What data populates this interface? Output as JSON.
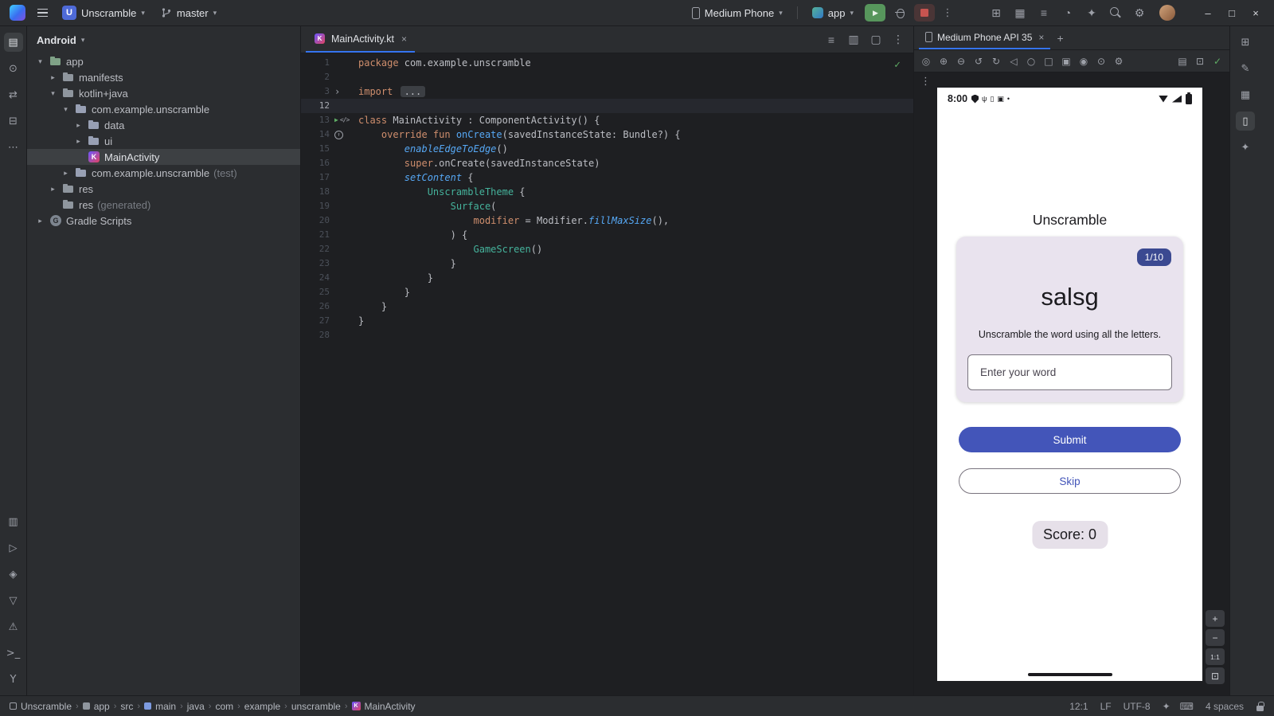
{
  "colors": {
    "accent": "#3574f0",
    "run_green": "#5fad65",
    "stop_red": "#c75450",
    "phone_primary": "#4355b9",
    "badge_bg": "#3b4991",
    "card_bg": "#e9e3ee",
    "score_bg": "#e6e0e9",
    "editor_bg": "#1e1f22",
    "panel_bg": "#2b2d30"
  },
  "titlebar": {
    "project_initial": "U",
    "project_name": "Unscramble",
    "branch": "master",
    "device_selector": "Medium Phone",
    "run_config": "app",
    "icons": [
      {
        "name": "layout-inspector-icon",
        "glyph": "⊞"
      },
      {
        "name": "device-manager-icon",
        "glyph": "▦"
      },
      {
        "name": "logcat-icon",
        "glyph": "≡"
      },
      {
        "name": "profiler-icon",
        "glyph": "◔"
      },
      {
        "name": "gemini-icon",
        "glyph": "✦"
      },
      {
        "name": "search-icon",
        "css": "mag"
      },
      {
        "name": "settings-icon",
        "glyph": "⚙"
      }
    ],
    "window_controls": [
      {
        "name": "minimize-button",
        "glyph": "–"
      },
      {
        "name": "maximize-button",
        "glyph": "□"
      },
      {
        "name": "close-button",
        "glyph": "×"
      }
    ]
  },
  "left_strip": {
    "top": [
      {
        "name": "project-tool-icon",
        "glyph": "▤",
        "active": true
      },
      {
        "name": "commit-tool-icon",
        "glyph": "⊙"
      },
      {
        "name": "pull-requests-icon",
        "glyph": "⇄"
      },
      {
        "name": "structure-tool-icon",
        "glyph": "⊟"
      },
      {
        "name": "more-tool-windows-icon",
        "glyph": "⋯"
      }
    ],
    "bottom": [
      {
        "name": "device-explorer-icon",
        "glyph": "▥"
      },
      {
        "name": "run-tool-icon",
        "glyph": "▷"
      },
      {
        "name": "build-tool-icon",
        "glyph": "◈"
      },
      {
        "name": "logcat-tool-icon",
        "glyph": "▽"
      },
      {
        "name": "problems-tool-icon",
        "glyph": "⚠"
      },
      {
        "name": "terminal-tool-icon",
        "glyph": ">_"
      },
      {
        "name": "version-control-tool-icon",
        "glyph": "Y"
      }
    ]
  },
  "right_strip": [
    {
      "name": "gradle-tool-icon",
      "glyph": "⊞"
    },
    {
      "name": "ai-assistant-tool-icon",
      "glyph": "✎"
    },
    {
      "name": "device-manager-tool-icon",
      "glyph": "▦"
    },
    {
      "name": "running-devices-tool-icon",
      "glyph": "▯",
      "active": true
    },
    {
      "name": "gemini-tool-icon",
      "glyph": "✦"
    }
  ],
  "project_panel": {
    "header": "Android",
    "tree": [
      {
        "label": "app",
        "level": 0,
        "chevron": "down",
        "icon": "module-app"
      },
      {
        "label": "manifests",
        "level": 1,
        "chevron": "right",
        "icon": "folder"
      },
      {
        "label": "kotlin+java",
        "level": 1,
        "chevron": "down",
        "icon": "folder"
      },
      {
        "label": "com.example.unscramble",
        "level": 2,
        "chevron": "down",
        "icon": "package"
      },
      {
        "label": "data",
        "level": 3,
        "chevron": "right",
        "icon": "package"
      },
      {
        "label": "ui",
        "level": 3,
        "chevron": "right",
        "icon": "package"
      },
      {
        "label": "MainActivity",
        "level": 3,
        "chevron": "none",
        "icon": "kotlin-class",
        "selected": true
      },
      {
        "label": "com.example.unscramble",
        "suffix": " (test)",
        "level": 2,
        "chevron": "right",
        "icon": "package"
      },
      {
        "label": "res",
        "level": 1,
        "chevron": "right",
        "icon": "folder-res"
      },
      {
        "label": "res",
        "suffix": " (generated)",
        "level": 1,
        "chevron": "none",
        "icon": "folder-res"
      },
      {
        "label": "Gradle Scripts",
        "level": 0,
        "chevron": "right",
        "icon": "gradle"
      }
    ]
  },
  "editor": {
    "tab_title": "MainActivity.kt",
    "inspection_glyph": "✓",
    "tabbar_icons": [
      {
        "name": "highlight-list-icon",
        "glyph": "≡"
      },
      {
        "name": "split-editor-icon",
        "glyph": "▥"
      },
      {
        "name": "detach-editor-icon",
        "glyph": "▢"
      },
      {
        "name": "editor-more-icon",
        "glyph": "⋮"
      }
    ],
    "lines": [
      {
        "n": "1",
        "tokens": [
          [
            "kw",
            "package "
          ],
          [
            "pl",
            "com.example.unscramble"
          ]
        ]
      },
      {
        "n": "2",
        "tokens": []
      },
      {
        "n": "3",
        "fold": true,
        "tokens": [
          [
            "kw",
            "import "
          ],
          [
            "folded",
            "..."
          ]
        ]
      },
      {
        "n": "12",
        "current": true,
        "tokens": []
      },
      {
        "n": "13",
        "gutter": "run",
        "tokens": [
          [
            "kw",
            "class "
          ],
          [
            "pl",
            "MainActivity : ComponentActivity() {"
          ]
        ]
      },
      {
        "n": "14",
        "gutter": "override",
        "tokens": [
          [
            "pl",
            "    "
          ],
          [
            "kw",
            "override fun "
          ],
          [
            "fn",
            "onCreate"
          ],
          [
            "pl",
            "(savedInstanceState: Bundle?) {"
          ]
        ]
      },
      {
        "n": "15",
        "tokens": [
          [
            "pl",
            "        "
          ],
          [
            "fni",
            "enableEdgeToEdge"
          ],
          [
            "pl",
            "()"
          ]
        ]
      },
      {
        "n": "16",
        "tokens": [
          [
            "pl",
            "        "
          ],
          [
            "kw",
            "super"
          ],
          [
            "pl",
            ".onCreate(savedInstanceState)"
          ]
        ]
      },
      {
        "n": "17",
        "tokens": [
          [
            "pl",
            "        "
          ],
          [
            "fni",
            "setContent"
          ],
          [
            "pl",
            " {"
          ]
        ]
      },
      {
        "n": "18",
        "tokens": [
          [
            "pl",
            "            "
          ],
          [
            "comp",
            "UnscrambleTheme"
          ],
          [
            "pl",
            " {"
          ]
        ]
      },
      {
        "n": "19",
        "tokens": [
          [
            "pl",
            "                "
          ],
          [
            "comp",
            "Surface"
          ],
          [
            "pl",
            "("
          ]
        ]
      },
      {
        "n": "20",
        "tokens": [
          [
            "pl",
            "                    "
          ],
          [
            "na",
            "modifier"
          ],
          [
            "pl",
            " = Modifier."
          ],
          [
            "fni",
            "fillMaxSize"
          ],
          [
            "pl",
            "(),"
          ]
        ]
      },
      {
        "n": "21",
        "tokens": [
          [
            "pl",
            "                ) {"
          ]
        ]
      },
      {
        "n": "22",
        "tokens": [
          [
            "pl",
            "                    "
          ],
          [
            "comp",
            "GameScreen"
          ],
          [
            "pl",
            "()"
          ]
        ]
      },
      {
        "n": "23",
        "tokens": [
          [
            "pl",
            "                }"
          ]
        ]
      },
      {
        "n": "24",
        "tokens": [
          [
            "pl",
            "            }"
          ]
        ]
      },
      {
        "n": "25",
        "tokens": [
          [
            "pl",
            "        }"
          ]
        ]
      },
      {
        "n": "26",
        "tokens": [
          [
            "pl",
            "    }"
          ]
        ]
      },
      {
        "n": "27",
        "tokens": [
          [
            "pl",
            "}"
          ]
        ]
      },
      {
        "n": "28",
        "tokens": []
      }
    ]
  },
  "device_panel": {
    "tab_title": "Medium Phone API 35",
    "toolbar_icons": [
      {
        "name": "power-icon",
        "glyph": "◎"
      },
      {
        "name": "volume-up-icon",
        "glyph": "⊕"
      },
      {
        "name": "volume-down-icon",
        "glyph": "⊖"
      },
      {
        "name": "rotate-left-icon",
        "glyph": "↺"
      },
      {
        "name": "rotate-right-icon",
        "glyph": "↻"
      },
      {
        "name": "back-icon",
        "glyph": "◁"
      },
      {
        "name": "home-icon",
        "glyph": "○"
      },
      {
        "name": "overview-icon",
        "glyph": "□"
      },
      {
        "name": "screenshot-icon",
        "glyph": "▣"
      },
      {
        "name": "screen-record-icon",
        "glyph": "◉"
      },
      {
        "name": "snapshot-icon",
        "glyph": "⊙"
      },
      {
        "name": "device-settings-icon",
        "glyph": "⚙"
      }
    ],
    "toolbar_right_icons": [
      {
        "name": "display-modes-icon",
        "glyph": "▤"
      },
      {
        "name": "fullscreen-icon",
        "glyph": "⊡"
      },
      {
        "name": "device-ready-icon",
        "glyph": "✓",
        "color": "#5fad65"
      }
    ],
    "zoom_controls": [
      {
        "name": "zoom-in-button",
        "glyph": "+"
      },
      {
        "name": "zoom-out-button",
        "glyph": "−"
      },
      {
        "name": "zoom-reset-button",
        "glyph": "1:1"
      },
      {
        "name": "zoom-fit-button",
        "glyph": "⊡"
      }
    ],
    "phone": {
      "status_time": "8:00",
      "status_icons": [
        {
          "name": "privacy-shield-icon",
          "css": "shield"
        },
        {
          "name": "usb-icon",
          "glyph": "ψ"
        },
        {
          "name": "vibrate-icon",
          "glyph": "▯"
        },
        {
          "name": "work-profile-icon",
          "glyph": "▣"
        },
        {
          "name": "status-dot-icon",
          "glyph": "•"
        }
      ],
      "app_title": "Unscramble",
      "round_counter": "1/10",
      "scrambled_word": "salsg",
      "instruction": "Unscramble the word using all the letters.",
      "input_placeholder": "Enter your word",
      "submit_label": "Submit",
      "skip_label": "Skip",
      "score_label": "Score: 0"
    }
  },
  "statusbar": {
    "breadcrumbs": [
      {
        "label": "Unscramble",
        "icon": "project"
      },
      {
        "label": "app",
        "icon": "module"
      },
      {
        "label": "src"
      },
      {
        "label": "main",
        "icon": "folder-main"
      },
      {
        "label": "java"
      },
      {
        "label": "com"
      },
      {
        "label": "example"
      },
      {
        "label": "unscramble"
      },
      {
        "label": "MainActivity",
        "icon": "kotlin"
      }
    ],
    "caret": "12:1",
    "line_sep": "LF",
    "encoding": "UTF-8",
    "indent": "4 spaces",
    "right_icons": [
      {
        "name": "gemini-status-icon",
        "glyph": "✦"
      },
      {
        "name": "screen-reader-icon",
        "glyph": "⌨"
      }
    ]
  }
}
